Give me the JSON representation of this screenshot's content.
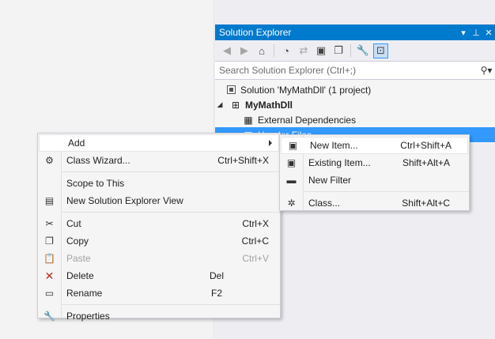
{
  "solution_explorer": {
    "title": "Solution Explorer",
    "title_buttons": [
      "▾",
      "⊥",
      "✕"
    ],
    "toolbar_icons": [
      {
        "name": "back-icon",
        "glyph": "◀"
      },
      {
        "name": "forward-icon",
        "glyph": "▶"
      },
      {
        "name": "home-icon",
        "glyph": "⌂"
      },
      {
        "name": "history-icon",
        "glyph": "◔"
      },
      {
        "name": "sync-icon",
        "glyph": "⇄"
      },
      {
        "name": "collapse-all-icon",
        "glyph": "▣"
      },
      {
        "name": "show-all-files-icon",
        "glyph": "❐"
      },
      {
        "name": "properties-wrench-icon",
        "glyph": "🔧"
      },
      {
        "name": "preview-selected-icon",
        "glyph": "⊡"
      }
    ],
    "search_placeholder": "Search Solution Explorer (Ctrl+;)",
    "tree": [
      {
        "label": "Solution 'MyMathDll' (1 project)",
        "expander": ""
      },
      {
        "label": "MyMathDll",
        "expander": "◢"
      },
      {
        "label": "External Dependencies",
        "expander": ""
      },
      {
        "label": "Header Files",
        "expander": ""
      }
    ]
  },
  "context_menu": {
    "items": [
      {
        "label": "Add",
        "shortcut": "",
        "icon": ""
      },
      {
        "label": "Class Wizard...",
        "shortcut": "Ctrl+Shift+X",
        "icon": "⚙"
      },
      {
        "label": "Scope to This",
        "shortcut": "",
        "icon": ""
      },
      {
        "label": "New Solution Explorer View",
        "shortcut": "",
        "icon": "▤"
      },
      {
        "label": "Cut",
        "shortcut": "Ctrl+X",
        "icon": "✂"
      },
      {
        "label": "Copy",
        "shortcut": "Ctrl+C",
        "icon": "❐"
      },
      {
        "label": "Paste",
        "shortcut": "Ctrl+V",
        "icon": "📋"
      },
      {
        "label": "Delete",
        "shortcut": "Del",
        "icon": "✕"
      },
      {
        "label": "Rename",
        "shortcut": "F2",
        "icon": "▭"
      },
      {
        "label": "Properties",
        "shortcut": "",
        "icon": "🔧"
      }
    ]
  },
  "add_submenu": {
    "items": [
      {
        "label": "New Item...",
        "shortcut": "Ctrl+Shift+A",
        "icon": "▣"
      },
      {
        "label": "Existing Item...",
        "shortcut": "Shift+Alt+A",
        "icon": "▣"
      },
      {
        "label": "New Filter",
        "shortcut": "",
        "icon": "▬"
      },
      {
        "label": "Class...",
        "shortcut": "Shift+Alt+C",
        "icon": "✲"
      }
    ]
  },
  "colors": {
    "accent": "#007acc",
    "selection": "#3399ff",
    "delete_red": "#c42b1c"
  }
}
